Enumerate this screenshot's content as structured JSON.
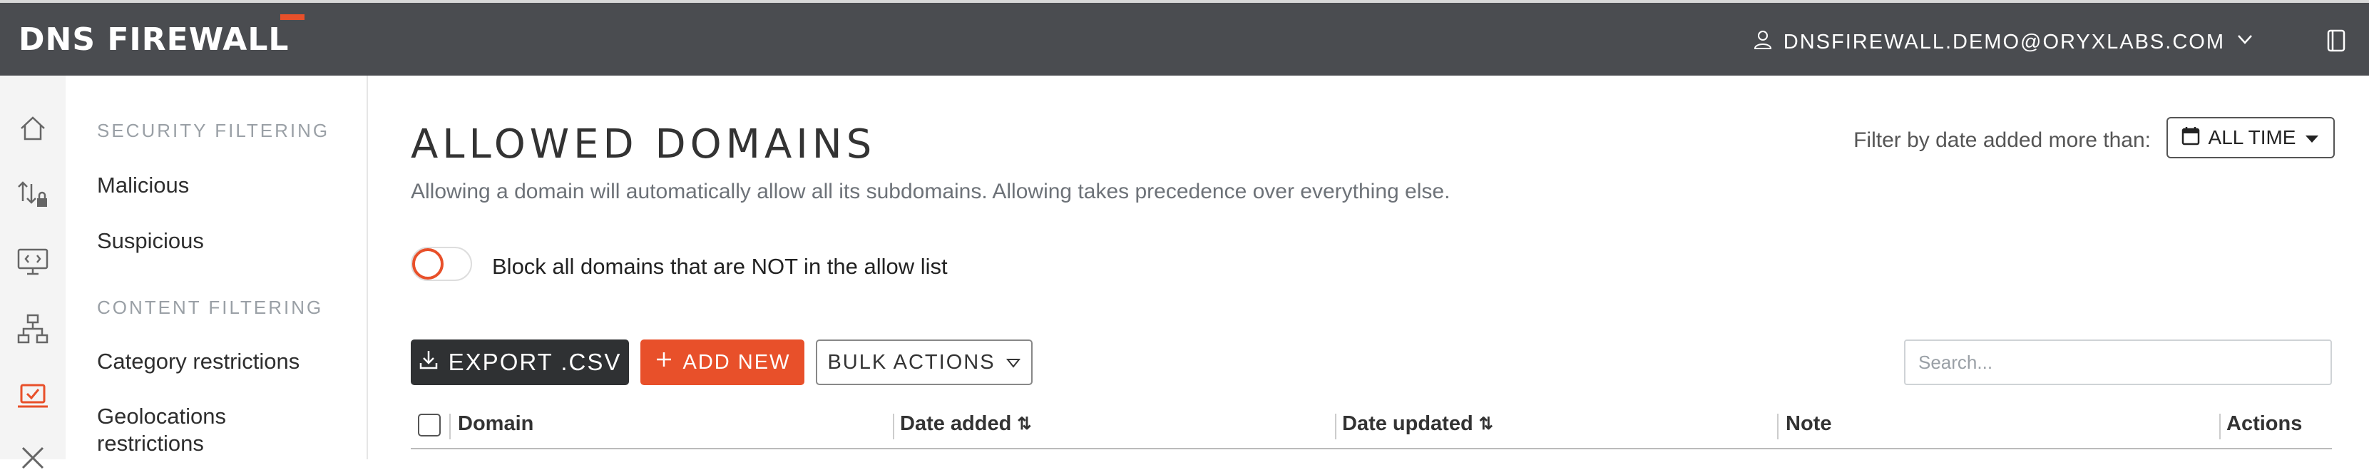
{
  "header": {
    "logo": "DNS FIREWALL",
    "user_email": "DNSFIREWALL.DEMO@ORYXLABS.COM",
    "accent_color": "#e8502a"
  },
  "rail": {
    "icons": [
      "home-icon",
      "traffic-lock-icon",
      "monitor-code-icon",
      "network-icon",
      "laptop-check-icon",
      "tools-icon"
    ],
    "active_index": 4
  },
  "subnav": {
    "sections": [
      {
        "heading": "SECURITY FILTERING",
        "items": [
          "Malicious",
          "Suspicious"
        ]
      },
      {
        "heading": "CONTENT FILTERING",
        "items": [
          "Category restrictions",
          "Geolocations restrictions"
        ]
      }
    ]
  },
  "page": {
    "title": "ALLOWED DOMAINS",
    "subtitle": "Allowing a domain will automatically allow all its subdomains. Allowing takes precedence over everything else.",
    "filter_label": "Filter by date added more than:",
    "filter_value": "ALL TIME",
    "toggle_label": "Block all domains that are NOT in the allow list",
    "toggle_on": false
  },
  "toolbar": {
    "export_label": "EXPORT .CSV",
    "add_label": "ADD NEW",
    "bulk_label": "BULK ACTIONS",
    "search_placeholder": "Search..."
  },
  "table": {
    "columns": [
      "Domain",
      "Date added",
      "Date updated",
      "Note",
      "Actions"
    ],
    "sortable": [
      false,
      true,
      true,
      false,
      false
    ],
    "rows": []
  }
}
